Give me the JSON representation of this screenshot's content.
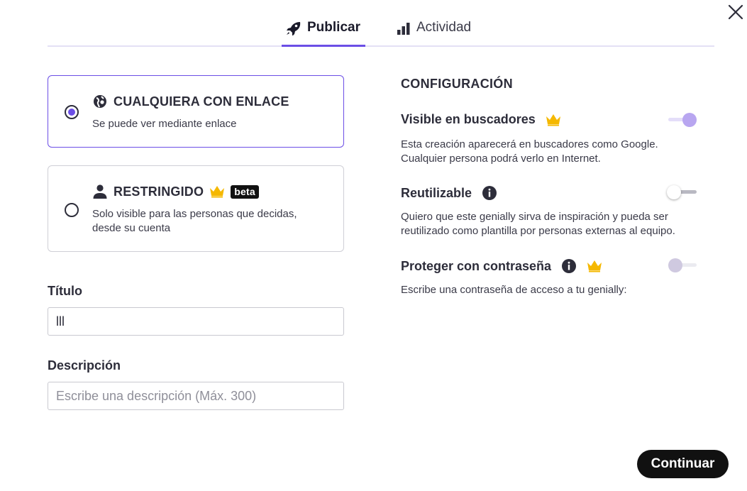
{
  "tabs": [
    {
      "label": "Publicar",
      "icon": "rocket-icon",
      "active": true
    },
    {
      "label": "Actividad",
      "icon": "bar-chart-icon",
      "active": false
    }
  ],
  "visibility": {
    "options": [
      {
        "title": "CUALQUIERA CON ENLACE",
        "subtitle": "Se puede ver mediante enlace",
        "icon": "link-globe-icon",
        "selected": true
      },
      {
        "title": "RESTRINGIDO",
        "badge": "beta",
        "subtitle": "Solo visible para las personas que decidas, desde su cuenta",
        "icon": "person-icon",
        "premium": true,
        "selected": false
      }
    ]
  },
  "form": {
    "title_label": "Título",
    "title_value": "lll",
    "description_label": "Descripción",
    "description_placeholder": "Escribe una descripción (Máx. 300)"
  },
  "config": {
    "heading": "CONFIGURACIÓN",
    "items": [
      {
        "title": "Visible en buscadores",
        "description": "Esta creación aparecerá en buscadores como Google. Cualquier persona podrá verlo en Internet.",
        "premium": true,
        "info": false,
        "toggle": "on"
      },
      {
        "title": "Reutilizable",
        "description": "Quiero que este genially sirva de inspiración y pueda ser reutilizado como plantilla por personas externas al equipo.",
        "premium": false,
        "info": true,
        "toggle": "off"
      },
      {
        "title": "Proteger con contraseña",
        "description": "Escribe una contraseña de acceso a tu genially:",
        "premium": true,
        "info": true,
        "toggle": "disabled"
      }
    ]
  },
  "actions": {
    "continue_label": "Continuar"
  },
  "colors": {
    "accent": "#6b4ee6",
    "crown": "#f5b800",
    "dark": "#111111"
  }
}
